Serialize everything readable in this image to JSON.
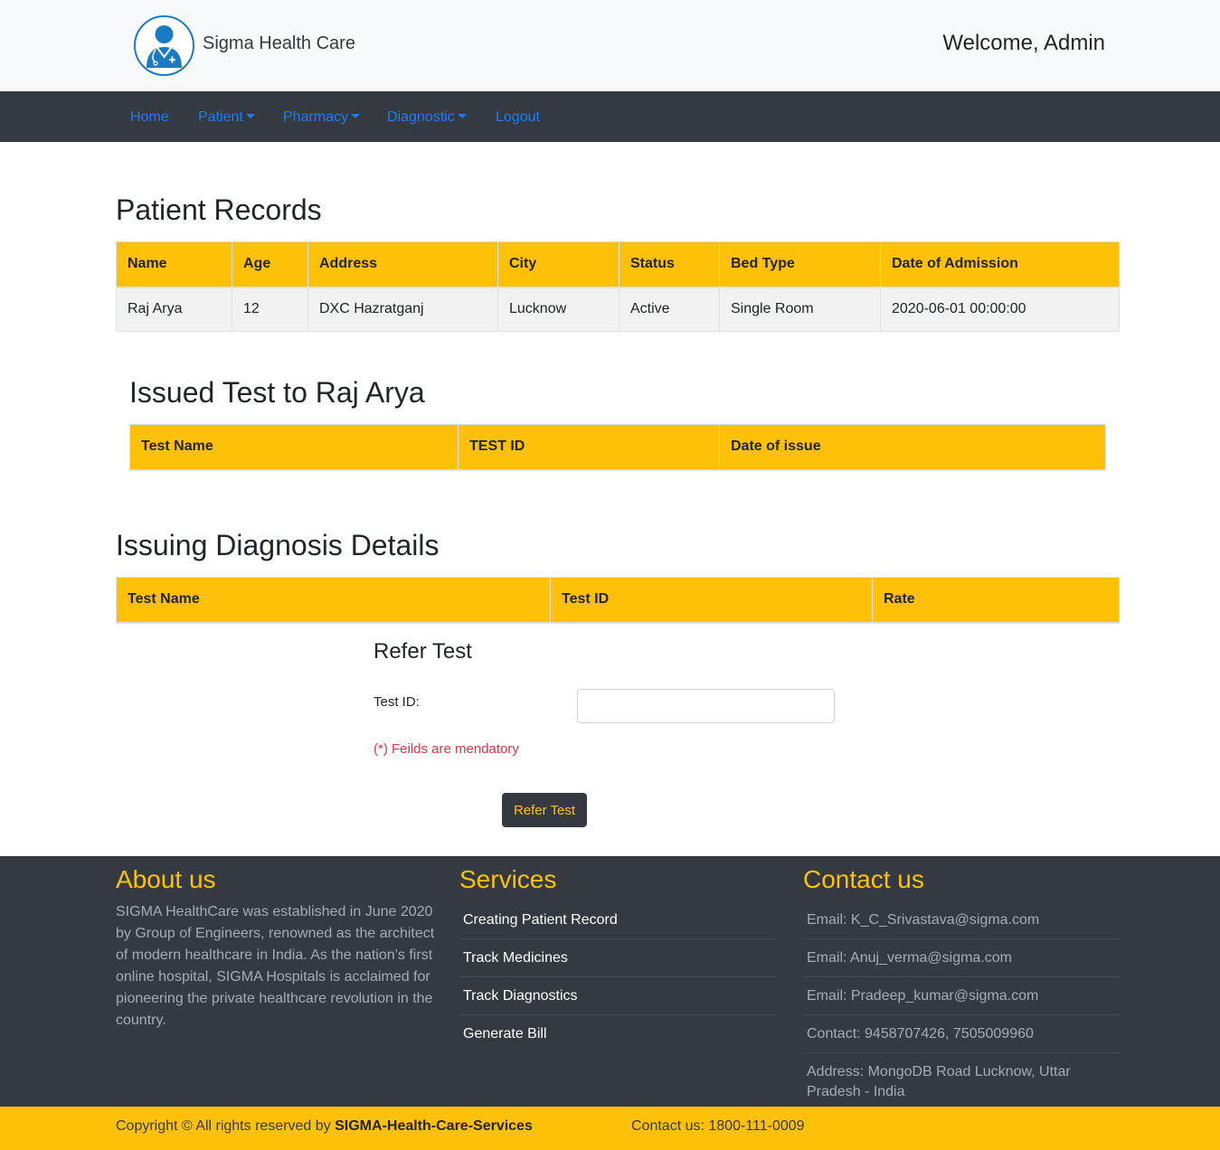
{
  "header": {
    "brand": "Sigma Health Care",
    "welcome": "Welcome, Admin"
  },
  "nav": {
    "home": "Home",
    "patient": "Patient",
    "pharmacy": "Pharmacy",
    "diagnostic": "Diagnostic",
    "logout": "Logout"
  },
  "patient_records": {
    "title": "Patient Records",
    "columns": [
      "Name",
      "Age",
      "Address",
      "City",
      "Status",
      "Bed Type",
      "Date of Admission"
    ],
    "rows": [
      [
        "Raj Arya",
        "12",
        "DXC Hazratganj",
        "Lucknow",
        "Active",
        "Single Room",
        "2020-06-01 00:00:00"
      ]
    ]
  },
  "issued_tests": {
    "title": "Issued Test to Raj Arya",
    "columns": [
      "Test Name",
      "TEST ID",
      "Date of issue"
    ]
  },
  "issuing_diagnosis": {
    "title": "Issuing Diagnosis Details",
    "columns": [
      "Test Name",
      "Test ID",
      "Rate"
    ]
  },
  "refer_form": {
    "title": "Refer Test",
    "test_id_label": "Test ID:",
    "test_id_value": "",
    "mandatory_note": "(*) Feilds are mendatory",
    "submit_label": "Refer Test"
  },
  "footer": {
    "about_title": "About us",
    "about_text": "SIGMA HealthCare was established in June 2020 by Group of Engineers, renowned as the architect of modern healthcare in India. As the nation’s first online hospital, SIGMA Hospitals is acclaimed for pioneering the private healthcare revolution in the country.",
    "services_title": "Services",
    "services": [
      "Creating Patient Record",
      "Track Medicines",
      "Track Diagnostics",
      "Generate Bill"
    ],
    "contact_title": "Contact us",
    "contacts": [
      "Email: K_C_Srivastava@sigma.com",
      "Email: Anuj_verma@sigma.com",
      "Email: Pradeep_kumar@sigma.com",
      "Contact: 9458707426, 7505009960",
      "Address: MongoDB Road Lucknow, Uttar Pradesh - India"
    ]
  },
  "bottom": {
    "copyright_prefix": "Copyright © All rights reserved by ",
    "copyright_brand": "SIGMA-Health-Care-Services",
    "contact": "Contact us: 1800-111-0009"
  },
  "colors": {
    "accent": "#ffc107",
    "dark": "#343a40",
    "link": "#1e7cf2",
    "danger": "#dc3545"
  }
}
